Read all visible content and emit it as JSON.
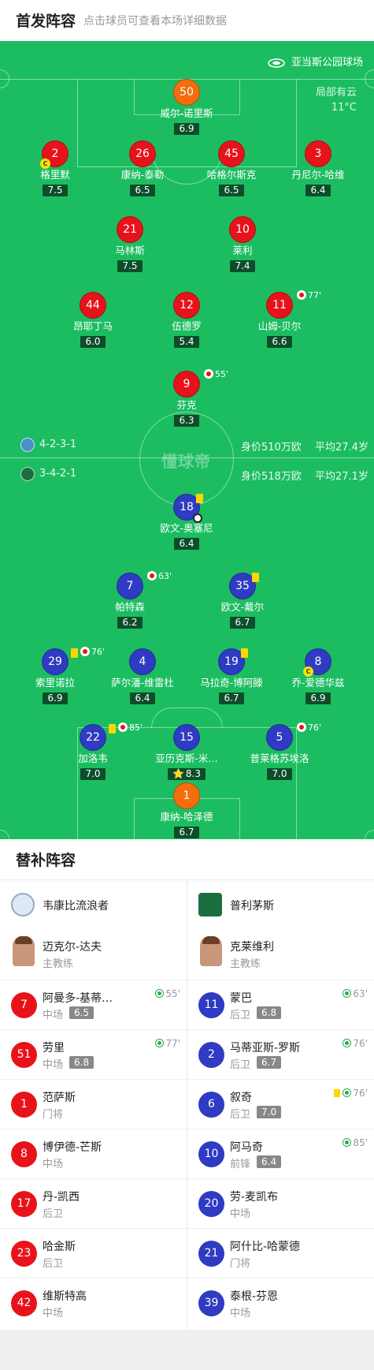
{
  "header": {
    "title": "首发阵容",
    "subtitle": "点击球员可查看本场详细数据"
  },
  "pitch": {
    "venue": "亚当斯公园球场",
    "weather": "局部有云",
    "temperature": "11°C",
    "watermark": "懂球帝",
    "home_team": {
      "formation": "4-2-3-1",
      "market_value": "身价510万欧",
      "avg_age": "平均27.4岁"
    },
    "away_team": {
      "formation": "3-4-2-1",
      "market_value": "身价518万欧",
      "avg_age": "平均27.1岁"
    }
  },
  "home_players": [
    {
      "number": "50",
      "name": "威尔-诺里斯",
      "rating": "6.9",
      "role": "gk"
    },
    {
      "number": "2",
      "name": "格里默",
      "rating": "7.5",
      "captain": true
    },
    {
      "number": "26",
      "name": "康纳-泰勒",
      "rating": "6.5"
    },
    {
      "number": "45",
      "name": "哈格尔斯克",
      "rating": "6.5"
    },
    {
      "number": "3",
      "name": "丹尼尔-哈维",
      "rating": "6.4"
    },
    {
      "number": "21",
      "name": "马林斯",
      "rating": "7.5"
    },
    {
      "number": "10",
      "name": "莱利",
      "rating": "7.4"
    },
    {
      "number": "44",
      "name": "昂耶丁马",
      "rating": "6.0"
    },
    {
      "number": "12",
      "name": "伍德罗",
      "rating": "5.4"
    },
    {
      "number": "11",
      "name": "山姆-贝尔",
      "rating": "6.6",
      "sub_minute": "77'"
    },
    {
      "number": "9",
      "name": "芬克",
      "rating": "6.3",
      "sub_minute": "55'"
    }
  ],
  "away_players": [
    {
      "number": "18",
      "name": "欧文-奥塞尼",
      "rating": "6.4",
      "yellow": true,
      "goal": true
    },
    {
      "number": "7",
      "name": "帕特森",
      "rating": "6.2",
      "sub_minute": "63'"
    },
    {
      "number": "35",
      "name": "欧文-戴尔",
      "rating": "6.7",
      "yellow": true
    },
    {
      "number": "29",
      "name": "索里诺拉",
      "rating": "6.9",
      "yellow": true,
      "sub_minute": "76'"
    },
    {
      "number": "4",
      "name": "萨尔潘-维雷杜",
      "rating": "6.4"
    },
    {
      "number": "19",
      "name": "马拉奇-博阿滕",
      "rating": "6.7",
      "yellow": true
    },
    {
      "number": "8",
      "name": "乔-爱德华兹",
      "rating": "6.9",
      "captain": true
    },
    {
      "number": "22",
      "name": "加洛韦",
      "rating": "7.0",
      "yellow": true,
      "sub_minute": "85'"
    },
    {
      "number": "15",
      "name": "亚历克斯-米…",
      "rating": "8.3",
      "star": "⭐"
    },
    {
      "number": "5",
      "name": "普莱格苏埃洛",
      "rating": "7.0",
      "sub_minute": "76'"
    },
    {
      "number": "1",
      "name": "康纳-哈泽德",
      "rating": "6.7",
      "role": "gk"
    }
  ],
  "subs": {
    "title": "替补阵容",
    "home": {
      "team_name": "韦康比流浪者",
      "coach": {
        "name": "迈克尔-达夫",
        "role": "主教练"
      },
      "players": [
        {
          "number": "7",
          "name": "阿曼多-基蒂…",
          "position": "中场",
          "rating": "6.5",
          "sub_minute": "55'"
        },
        {
          "number": "51",
          "name": "劳里",
          "position": "中场",
          "rating": "6.8",
          "sub_minute": "77'"
        },
        {
          "number": "1",
          "name": "范萨斯",
          "position": "门将"
        },
        {
          "number": "8",
          "name": "博伊德-芒斯",
          "position": "中场"
        },
        {
          "number": "17",
          "name": "丹-凯西",
          "position": "后卫"
        },
        {
          "number": "23",
          "name": "哈金斯",
          "position": "后卫"
        },
        {
          "number": "42",
          "name": "维斯特高",
          "position": "中场"
        }
      ]
    },
    "away": {
      "team_name": "普利茅斯",
      "coach": {
        "name": "克莱维利",
        "role": "主教练"
      },
      "players": [
        {
          "number": "11",
          "name": "蒙巴",
          "position": "后卫",
          "rating": "6.8",
          "sub_minute": "63'"
        },
        {
          "number": "2",
          "name": "马蒂亚斯-罗斯",
          "position": "后卫",
          "rating": "6.7",
          "sub_minute": "76'"
        },
        {
          "number": "6",
          "name": "叙奇",
          "position": "后卫",
          "rating": "7.0",
          "sub_minute": "76'",
          "yellow": true
        },
        {
          "number": "10",
          "name": "阿马奇",
          "position": "前锋",
          "rating": "6.4",
          "sub_minute": "85'"
        },
        {
          "number": "20",
          "name": "劳-麦凯布",
          "position": "中场"
        },
        {
          "number": "21",
          "name": "阿什比-哈蒙德",
          "position": "门将"
        },
        {
          "number": "39",
          "name": "泰根-芬恩",
          "position": "中场"
        }
      ]
    }
  },
  "colors": {
    "pitch": "#1cbd61",
    "home_shirt": "#e8131a",
    "away_shirt": "#2f3bc2",
    "goalkeeper": "#f46e0d"
  },
  "icons": [
    "stadium-icon",
    "captain-icon",
    "yellow-card-icon",
    "sub-off-icon",
    "sub-on-icon",
    "goal-ball-icon",
    "team-logo-icon"
  ]
}
